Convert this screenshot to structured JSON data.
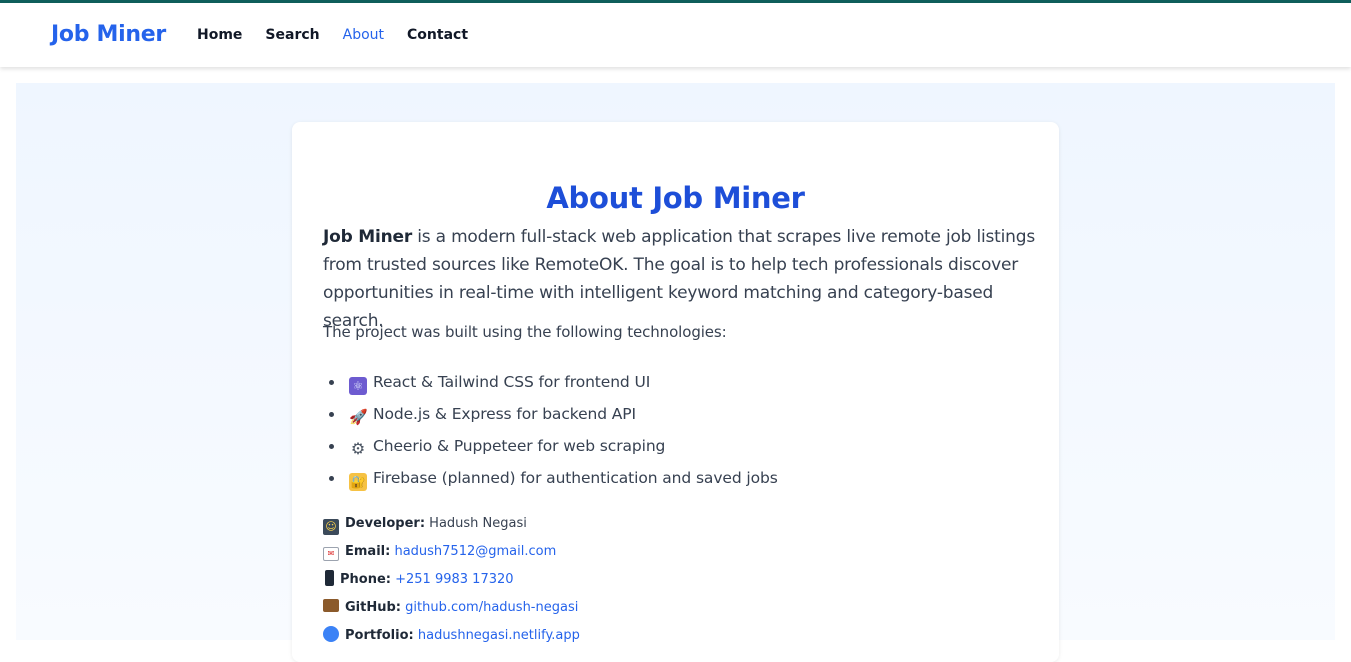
{
  "nav": {
    "brand": "Job Miner",
    "links": [
      {
        "label": "Home",
        "active": false
      },
      {
        "label": "Search",
        "active": false
      },
      {
        "label": "About",
        "active": true
      },
      {
        "label": "Contact",
        "active": false
      }
    ]
  },
  "about": {
    "title": "About Job Miner",
    "intro_bold": "Job Miner",
    "intro_text": " is a modern full-stack web application that scrapes live remote job listings from trusted sources like RemoteOK. The goal is to help tech professionals discover opportunities in real-time with intelligent keyword matching and category-based search.",
    "tech_intro": "The project was built using the following technologies:",
    "tech": [
      {
        "icon": "react-icon",
        "glyph": "⚛",
        "text": "React & Tailwind CSS for frontend UI"
      },
      {
        "icon": "rocket-icon",
        "glyph": "🚀",
        "text": "Node.js & Express for backend API"
      },
      {
        "icon": "gear-icon",
        "glyph": "⚙",
        "text": "Cheerio & Puppeteer for web scraping"
      },
      {
        "icon": "lock-icon",
        "glyph": "🔐",
        "text": "Firebase (planned) for authentication and saved jobs"
      }
    ],
    "contact": {
      "developer_label": "Developer:",
      "developer_value": "Hadush Negasi",
      "email_label": "Email:",
      "email_value": "hadush7512@gmail.com",
      "phone_label": "Phone:",
      "phone_value": "+251 9983 17320",
      "github_label": "GitHub:",
      "github_value": "github.com/hadush-negasi",
      "portfolio_label": "Portfolio:",
      "portfolio_value": "hadushnegasi.netlify.app"
    }
  },
  "colors": {
    "brand": "#2563eb",
    "title": "#1d4ed8",
    "top_line": "#0f5f5c",
    "page_bg": "#eff6ff"
  }
}
